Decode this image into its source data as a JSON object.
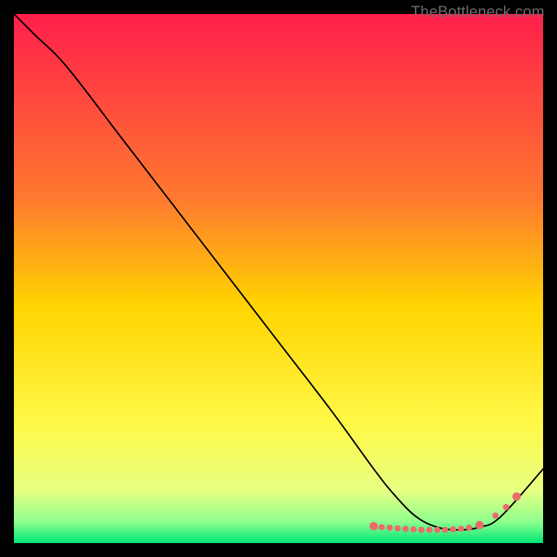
{
  "watermark": "TheBottleneck.com",
  "chart_data": {
    "type": "line",
    "title": "",
    "xlabel": "",
    "ylabel": "",
    "xlim": [
      0,
      100
    ],
    "ylim": [
      0,
      100
    ],
    "grid": false,
    "legend": false,
    "background_gradient": {
      "stops": [
        {
          "offset": 0,
          "color": "#ff1f4b"
        },
        {
          "offset": 35,
          "color": "#ff7a2f"
        },
        {
          "offset": 55,
          "color": "#ffd400"
        },
        {
          "offset": 78,
          "color": "#fff94a"
        },
        {
          "offset": 90,
          "color": "#e8ff82"
        },
        {
          "offset": 96,
          "color": "#8dff8d"
        },
        {
          "offset": 100,
          "color": "#00e676"
        }
      ]
    },
    "series": [
      {
        "name": "curve",
        "color": "#000000",
        "x": [
          0,
          4,
          10,
          20,
          30,
          40,
          50,
          60,
          68,
          72,
          76,
          80,
          84,
          88,
          92,
          100
        ],
        "y": [
          100,
          96,
          90,
          77,
          64,
          51,
          38,
          25,
          14,
          9,
          5,
          3,
          2.5,
          3,
          5,
          14
        ]
      }
    ],
    "markers": {
      "name": "bottom-markers",
      "color": "#ec6b6b",
      "radius_small": 4.5,
      "radius_large": 6,
      "points": [
        {
          "x": 68,
          "y": 3.2,
          "r": "large"
        },
        {
          "x": 69.5,
          "y": 3.0,
          "r": "small"
        },
        {
          "x": 71,
          "y": 2.9,
          "r": "small"
        },
        {
          "x": 72.5,
          "y": 2.8,
          "r": "small"
        },
        {
          "x": 74,
          "y": 2.7,
          "r": "small"
        },
        {
          "x": 75.5,
          "y": 2.6,
          "r": "small"
        },
        {
          "x": 77,
          "y": 2.5,
          "r": "small"
        },
        {
          "x": 78.5,
          "y": 2.5,
          "r": "small"
        },
        {
          "x": 80,
          "y": 2.5,
          "r": "small"
        },
        {
          "x": 81.5,
          "y": 2.5,
          "r": "small"
        },
        {
          "x": 83,
          "y": 2.6,
          "r": "small"
        },
        {
          "x": 84.5,
          "y": 2.7,
          "r": "small"
        },
        {
          "x": 86,
          "y": 2.9,
          "r": "small"
        },
        {
          "x": 88,
          "y": 3.4,
          "r": "large"
        },
        {
          "x": 91,
          "y": 5.2,
          "r": "small"
        },
        {
          "x": 93,
          "y": 6.8,
          "r": "small"
        },
        {
          "x": 95,
          "y": 8.8,
          "r": "large"
        }
      ]
    }
  }
}
